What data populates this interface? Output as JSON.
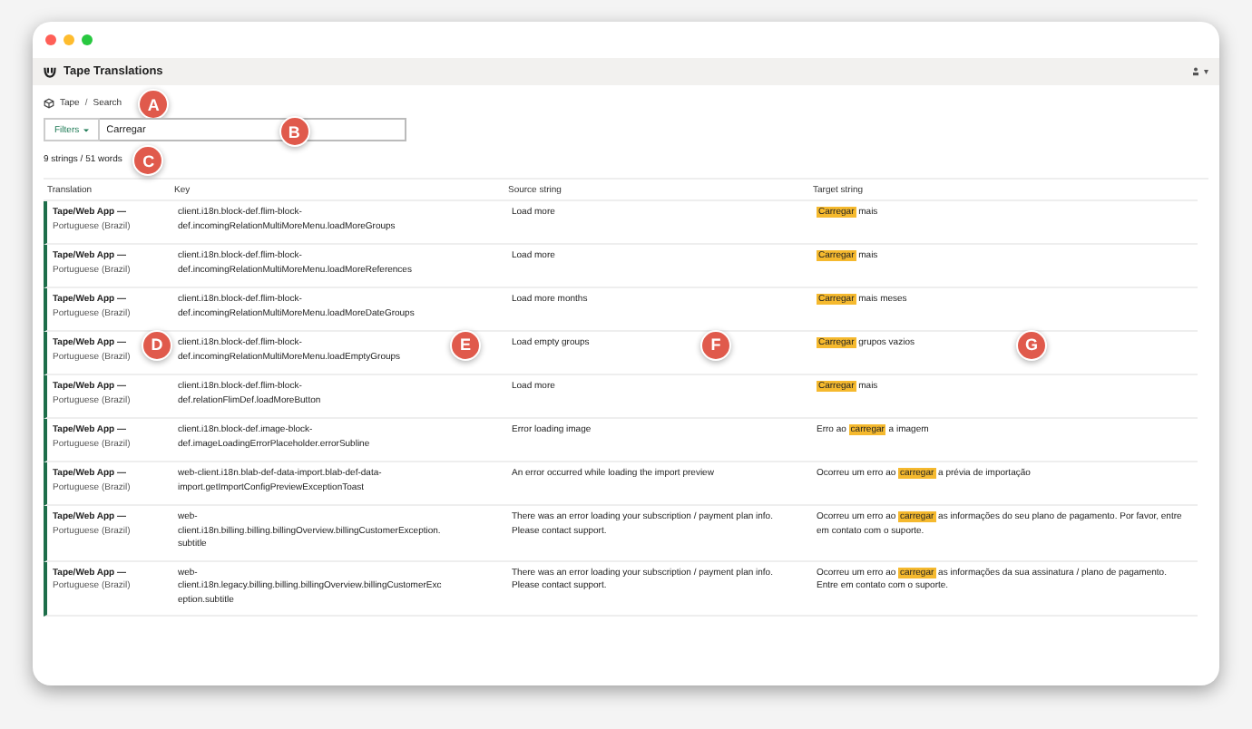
{
  "app": {
    "title": "Tape Translations",
    "user_menu": "▾"
  },
  "breadcrumb": {
    "items": [
      "Tape",
      "Search"
    ],
    "separator": "/"
  },
  "search": {
    "filter_label": "Filters",
    "value": "Carregar"
  },
  "count": "9 strings / 51 words",
  "table": {
    "columns": [
      "Translation",
      "Key",
      "Source string",
      "Target string"
    ],
    "rows": [
      {
        "project": "Tape/Web App —",
        "language": "Portuguese (Brazil)",
        "key": "client.i18n.block-def.flim-block-def.incomingRelationMultiMoreMenu.loadMoreGroups",
        "source": "Load more",
        "target": {
          "match": "Carregar",
          "after": " mais"
        }
      },
      {
        "project": "Tape/Web App —",
        "language": "Portuguese (Brazil)",
        "key": "client.i18n.block-def.flim-block-def.incomingRelationMultiMoreMenu.loadMoreReferences",
        "source": "Load more",
        "target": {
          "match": "Carregar",
          "after": " mais"
        }
      },
      {
        "project": "Tape/Web App —",
        "language": "Portuguese (Brazil)",
        "key": "client.i18n.block-def.flim-block-def.incomingRelationMultiMoreMenu.loadMoreDateGroups",
        "source": "Load more months",
        "target": {
          "match": "Carregar",
          "after": " mais meses"
        }
      },
      {
        "project": "Tape/Web App —",
        "language": "Portuguese (Brazil)",
        "key": "client.i18n.block-def.flim-block-def.incomingRelationMultiMoreMenu.loadEmptyGroups",
        "source": "Load empty groups",
        "target": {
          "match": "Carregar",
          "after": " grupos vazios"
        }
      },
      {
        "project": "Tape/Web App —",
        "language": "Portuguese (Brazil)",
        "key": "client.i18n.block-def.flim-block-def.relationFlimDef.loadMoreButton",
        "source": "Load more",
        "target": {
          "match": "Carregar",
          "after": " mais"
        }
      },
      {
        "project": "Tape/Web App —",
        "language": "Portuguese (Brazil)",
        "key": "client.i18n.block-def.image-block-def.imageLoadingErrorPlaceholder.errorSubline",
        "source": "Error loading image",
        "target": {
          "before": "Erro ao ",
          "match": "carregar",
          "after": " a imagem"
        }
      },
      {
        "project": "Tape/Web App —",
        "language": "Portuguese (Brazil)",
        "key": "web-client.i18n.blab-def-data-import.blab-def-data-import.getImportConfigPreviewExceptionToast",
        "source": "An error occurred while loading the import preview",
        "target": {
          "before": "Ocorreu um erro ao ",
          "match": "carregar",
          "after": " a prévia de importação"
        }
      },
      {
        "project": "Tape/Web App —",
        "language": "Portuguese (Brazil)",
        "key": "web-client.i18n.billing.billing.billingOverview.billingCustomerException.subtitle",
        "source": "There was an error loading your subscription / payment plan info. Please contact support.",
        "target": {
          "before": "Ocorreu um erro ao ",
          "match": "carregar",
          "after": " as informações do seu plano de pagamento. Por favor, entre em contato com o suporte."
        }
      },
      {
        "project": "Tape/Web App —",
        "language": "Portuguese (Brazil)",
        "key": "web-client.i18n.legacy.billing.billing.billingOverview.billingCustomerException.subtitle",
        "source": "There was an error loading your subscription / payment plan info. Please contact support.",
        "target": {
          "before": "Ocorreu um erro ao ",
          "match": "carregar",
          "after": " as informações da sua assinatura / plano de pagamento. Entre em contato com o suporte."
        }
      }
    ]
  },
  "callouts": [
    "A",
    "B",
    "C",
    "D",
    "E",
    "F",
    "G"
  ]
}
